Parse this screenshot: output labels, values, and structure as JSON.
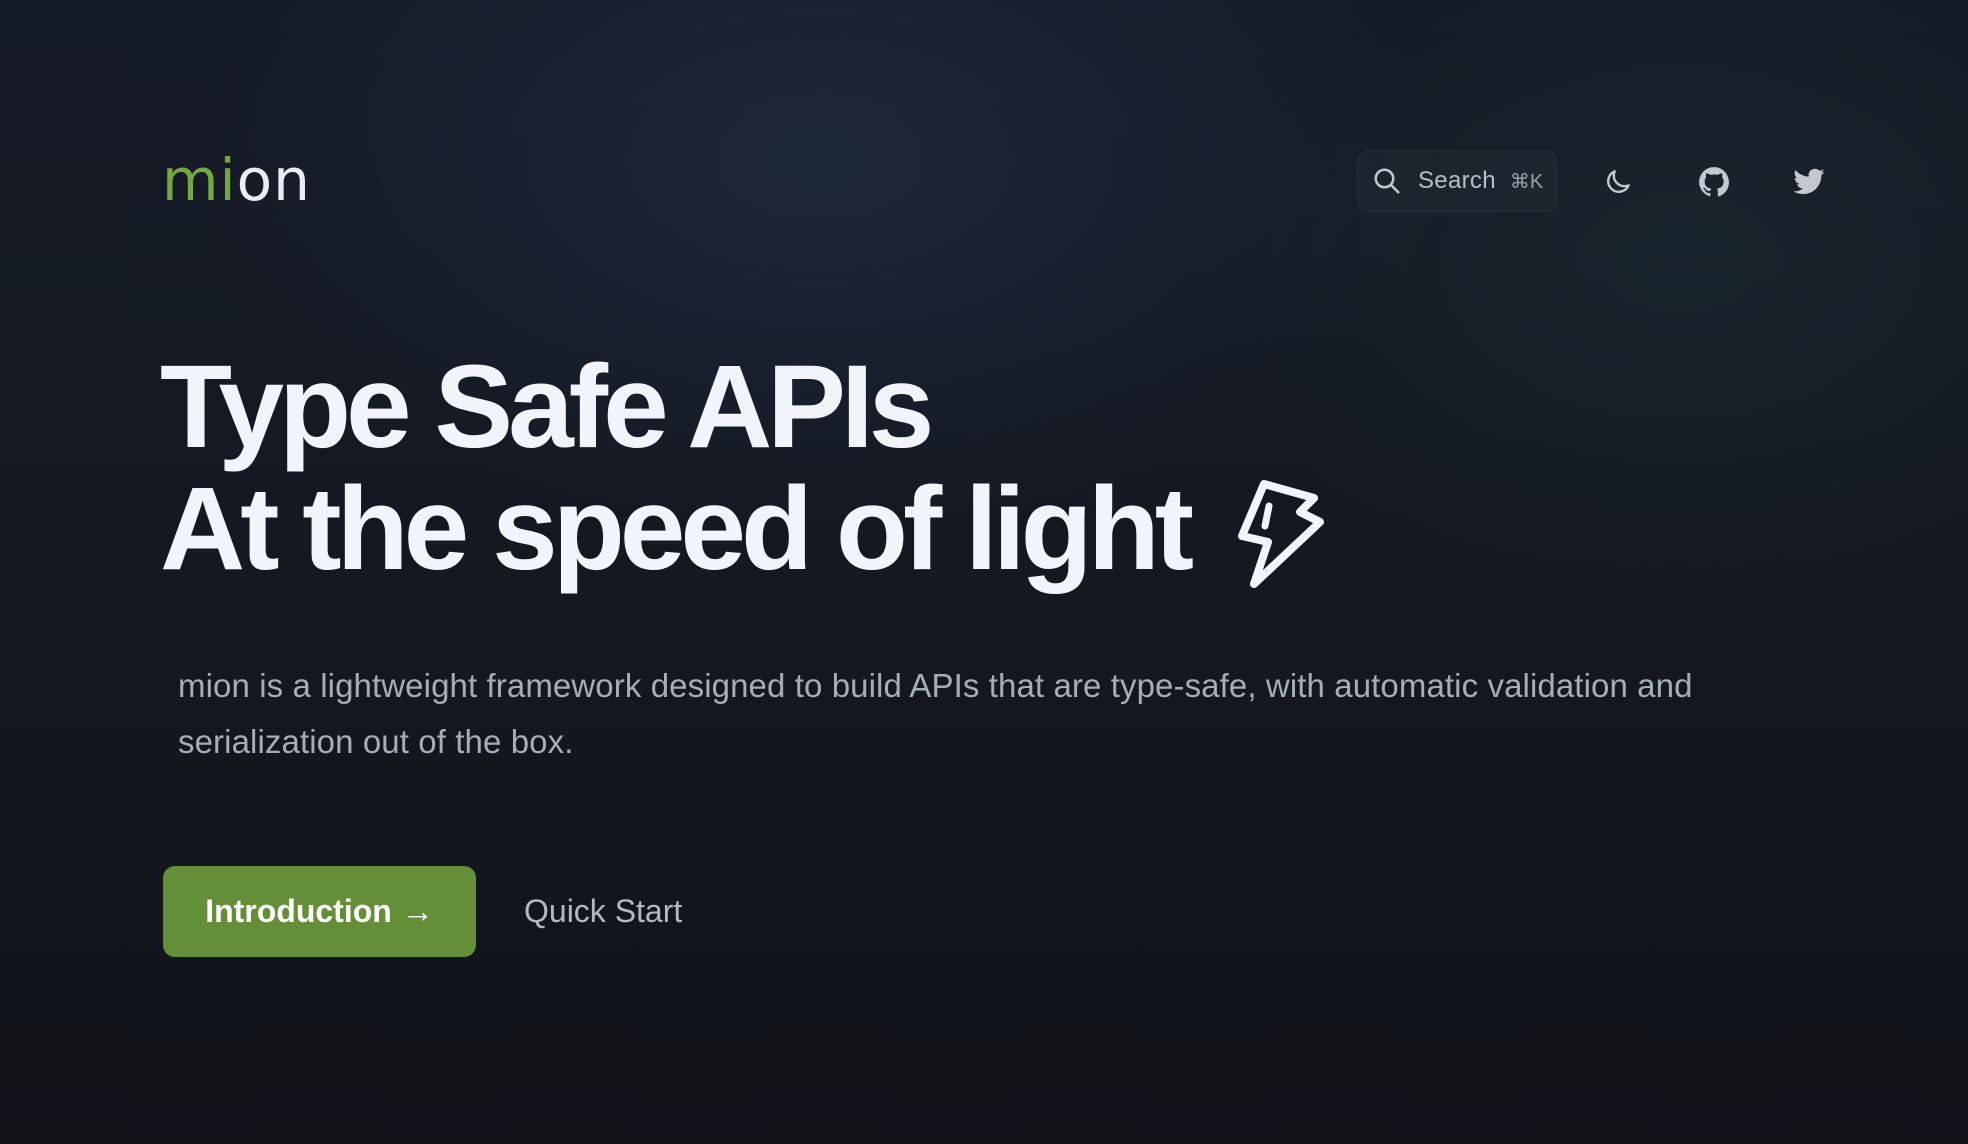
{
  "header": {
    "logo": {
      "accent": "mi",
      "rest": "on"
    },
    "search": {
      "label": "Search",
      "shortcut": "⌘K",
      "icon": "search-icon"
    },
    "icons": [
      "moon-icon",
      "github-icon",
      "twitter-icon"
    ]
  },
  "hero": {
    "title_line1": "Type Safe APIs",
    "title_line2": "At the speed of light",
    "title_icon": "lightning-bolt-icon",
    "description": "mion is a lightweight framework designed to build APIs that are type-safe, with automatic validation and serialization out of the box.",
    "primary_button": {
      "label": "Introduction",
      "arrow": "→"
    },
    "secondary_button": {
      "label": "Quick Start"
    }
  },
  "colors": {
    "accent": "#72a83f",
    "button": "#648f38",
    "background": "#13161f",
    "text": "#f1f5fb"
  }
}
